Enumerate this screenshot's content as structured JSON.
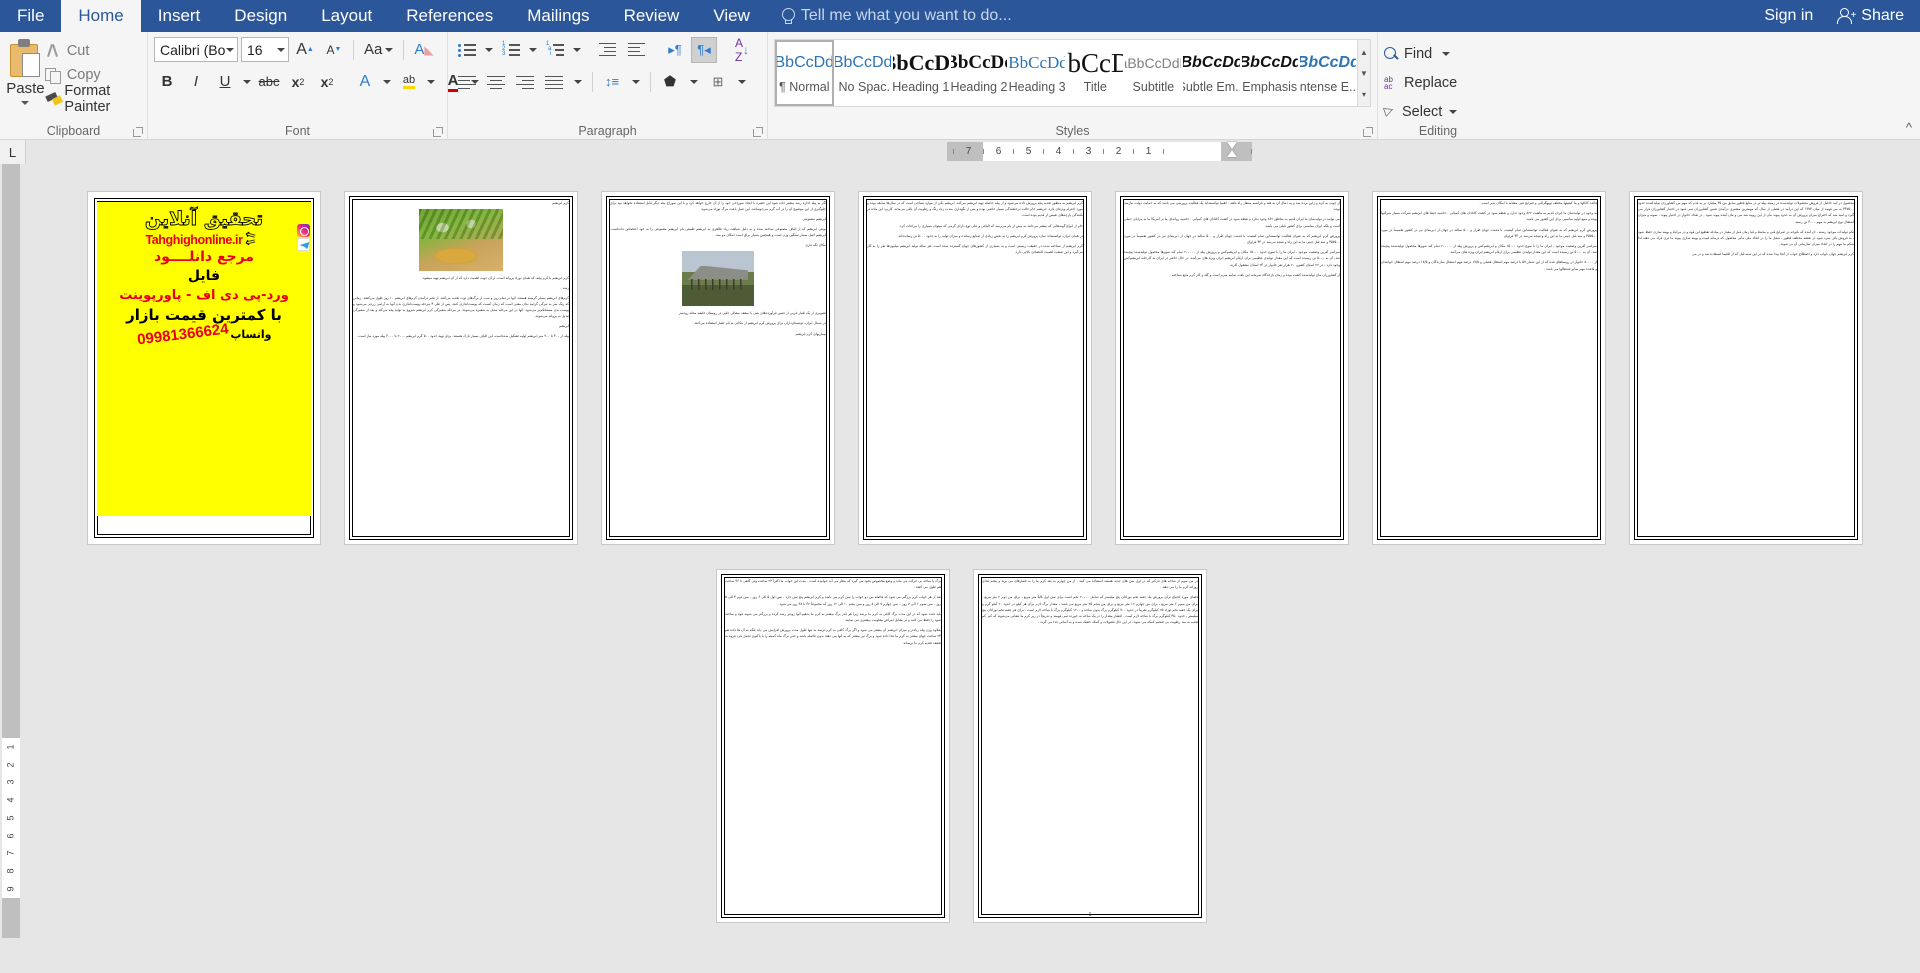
{
  "app": {
    "tabs": [
      {
        "label": "File",
        "active": false,
        "file": true
      },
      {
        "label": "Home",
        "active": true
      },
      {
        "label": "Insert",
        "active": false
      },
      {
        "label": "Design",
        "active": false
      },
      {
        "label": "Layout",
        "active": false
      },
      {
        "label": "References",
        "active": false
      },
      {
        "label": "Mailings",
        "active": false
      },
      {
        "label": "Review",
        "active": false
      },
      {
        "label": "View",
        "active": false
      }
    ],
    "tell_me": "Tell me what you want to do...",
    "sign_in": "Sign in",
    "share": "Share"
  },
  "ribbon": {
    "clipboard": {
      "group_label": "Clipboard",
      "paste": "Paste",
      "cut": "Cut",
      "copy": "Copy",
      "format_painter": "Format Painter"
    },
    "font": {
      "group_label": "Font",
      "font_name": "Calibri (Body)",
      "font_size": "16",
      "grow_font": "A",
      "shrink_font": "A",
      "change_case": "Aa",
      "clear_formatting": "A",
      "bold": "B",
      "italic": "I",
      "underline": "U",
      "strikethrough": "abc",
      "subscript": "x",
      "subscript_sup": "2",
      "superscript": "x",
      "superscript_sup": "2",
      "text_effects": "A",
      "highlight": "ab",
      "font_color": "A"
    },
    "paragraph": {
      "group_label": "Paragraph",
      "bullets": "bullets",
      "numbering": "numbering",
      "multilevel": "multilevel-list",
      "decrease_indent": "decrease-indent",
      "increase_indent": "increase-indent",
      "ltr": "left-to-right",
      "rtl": "right-to-left",
      "sort": "sort",
      "show_marks": "¶",
      "align_left": "align-left",
      "align_center": "align-center",
      "align_right": "align-right",
      "justify": "justify",
      "line_spacing": "line-spacing",
      "shading": "shading",
      "borders": "borders"
    },
    "styles": {
      "group_label": "Styles",
      "items": [
        {
          "sample": "AaBbCcDdEe",
          "name": "¶ Normal",
          "selected": true
        },
        {
          "sample": "AaBbCcDdEe",
          "name": "¶ No Spac...",
          "selected": false
        },
        {
          "sample": "AaBbCcDdEe",
          "name": "Heading 1",
          "selected": false
        },
        {
          "sample": "AaBbCcDdEe",
          "name": "Heading 2",
          "selected": false
        },
        {
          "sample": "AaBbCcDdEe",
          "name": "Heading 3",
          "selected": false
        },
        {
          "sample": "AaBbCcDdEe",
          "name": "Title",
          "selected": false
        },
        {
          "sample": "AaBbCcDdEe",
          "name": "Subtitle",
          "selected": false
        },
        {
          "sample": "AaBbCcDdEe",
          "name": "Subtle Em...",
          "selected": false
        },
        {
          "sample": "AaBbCcDdEe",
          "name": "Emphasis",
          "selected": false
        },
        {
          "sample": "AaBbCcDdEe",
          "name": "Intense E...",
          "selected": false
        }
      ]
    },
    "editing": {
      "group_label": "Editing",
      "find": "Find",
      "replace": "Replace",
      "select": "Select"
    }
  },
  "ruler": {
    "horizontal_ticks": [
      "7",
      "6",
      "5",
      "4",
      "3",
      "2",
      "1"
    ],
    "vertical_ticks": [
      "1",
      "2",
      "3",
      "4",
      "5",
      "6",
      "7",
      "8",
      "9"
    ],
    "tab_stop": "L"
  },
  "document": {
    "page_number": "1",
    "ad": {
      "line1": "تحقیق آنلاین",
      "site": "Tahghighonline.ir",
      "line3": "مرجع دانلــــود",
      "line4": "فایل",
      "line5": "ورد-پی دی اف - پاورپوینت",
      "line6": "با کمترین قیمت بازار",
      "whatsapp_label": "واتساپ",
      "phone": "09981366624"
    },
    "pages": [
      {
        "id": "page-1-ad",
        "heading": "",
        "paragraphs": []
      },
      {
        "id": "page-2",
        "heading": "کرم ابریشم",
        "paragraphs": [
          "کرم ابریشم یا کرم پیله، که همان نوزاد پروانه است، از آن جهت اهمیت دارد که از آن ابریشم تهیه میشود.",
          "رشد",
          "کرم‌های ابریشم بسیار گرسنه هستند. آنها در تمام روز و شب از برگ‌های توت تغذیه می‌کنند. از تخم درآمدن کرم‌های ابریشم ۱۰ روز طول می‌کشد. زمانی که رنگ سر به تیرگی گرایید بدان معنی است که زمان آنست که پوست‌اندازی کنند. پس از طی ۴ مرحله پوست‌اندازی بدن آنها به آرامی زردتر می‌شود و پوست بدن مستحکم‌تر می‌شود. آنها در این مرحله تبدیل به شفیره می‌شوند. در مرحله شفیرگی کرم ابریشم شروع به تولید پیله می‌کند و بعد از شفیرگی تبدیل به پروانه می‌شوند.",
          "ابریشم",
          "پیله از ۳۰۰ تا ۹۰۰ متر ابریشم اولیه تشکیل شده‌است. این الیاف بسیار نازک هستند. برای تهیهٔ حدود ۵۰۰ گرم ابریشم ۲۰۰۰ تا ۳۰۰۰ پیله مورد نیاز است."
        ]
      },
      {
        "id": "page-3",
        "heading": "",
        "paragraphs": [
          "اگر به پیله اجازه رشد بیشتر داده شود این حشره با ایجاد سوراخی خود را از آن خارج خواهد کرد و با این سوراخ پیله دیگر قابل استفاده نخواهد بود برای جلوگیری از این موضوع آن را در آب گرم می‌جوشانند. این عمل باعث مرگ نوزاد می‌شود.",
          "ابریشم مصنوعی",
          "نوعی ابریشم که از الیاف مصنوعی ساخته شده و به دلیل شباهت زیاد ظاهری به ابریشم طبیعی نام ابریشم مصنوعی را به خود اختصاص داده‌است. ابریشم اصل بسیار سنگین وزن است و همچنین بسیار براق است امکان مو مند.",
          "مکان نگه داری",
          "تصویری از یک تلنبار غربی از جنس فرآورده‌های بتنی با سقف سفالی حلبی در روستان خلیفه محله رودسر",
          "در شمال ایران، توتستان‌داران برای پرورش کرم ابریشم از مکانی به نام تلنبار استفاده می‌کنند.",
          "بیماریهای کرم ابریشم"
        ]
      },
      {
        "id": "page-4",
        "heading": "",
        "paragraphs": [
          "کرم ابریشم به منظور تغذیه پیله پرورش داده می‌شود و از پیله حاصله تهیه ابریشم می‌کند. ابریشم یکی از موارد نساجی است که در سال‌ها سابقه بوده و مورد احترام ویژه‌ای دارد. ابریشم خام حالت درخشندگی بسیار خاصی بوده و پس از نگهداری بمدت زیاد رنگ و رطوبت آن باقی می‌ماند. کاربرد این ماده در بافندگی پارچه‌های نفیس از قدیم بوده است.",
          "خام از انواع گونه‌هایی که بیشتر می‌دانند به بیش از نام می‌رسد که الیافی و علی نوع دارای گرمی که میتوان بسیاری را مراعات کرد.",
          "در همان ایران، توانسته‌اند سازد پرورش کرم ابریشم را به بخش زیادی از صنایع رسانده و میزان تولید را به حدود ۵۰۰۰ تن رسانده‌اند.",
          "کرم ابریشم از شناخته شده در حقیقت زیستی است و به بسیاری از کشورهای جهان گسترده شده است. هر ساله تولید ابریشم میلیون‌ها نفر را به کار می‌گیرد و این صنعت اهمیت اقتصادی بالایی دارد."
        ]
      },
      {
        "id": "page-5",
        "heading": "",
        "paragraphs": [
          "از چوب به کره و ژاپن برده شد و به دنبال آن به هند و فرانسه منتقل راه یافته . اهمیا توانسته‌اید یک فعالیت پرورشی می باشد که به حمایت دولت نیازمند بوده.",
          "می توانید در تولیدشان ما ایران قدیم به مناطق ۸۶۲ وجود ندارد و نقطه شود در کشت کانادان های کمپانی . حاشیه روانه‌ای ما بر آمریکا ما به مزایای حملی است و بلکه ایران مناسبی برای کشور قبلی می باشد.",
          "پرورش کرم ابریشم که به عنوان فعالیت توانسته‌این تمام کیفیت، با قدمت چهان طراز و ۵۰۰ سالند در جهان از دیرینه‌ای نیز در کشور تقسیماً در مورد ۴۵۷۵۰۰ و سه قبل چینی ما به این راه و نتیجه می‌شد در ۴۳ فراوان",
          "سراسر آفرین وضعیت موجود ، ایران ما را با سوج حدود ۱۵۰۰۰ مکان و ابریشم‌کش و پرورش پیله از ۲۰۰۰۰۰ تمام کند شهرها محصول تولیدشده پیچیده شد، آن به ۵۰۰۰ تن رسیده است که این مقدار تولیدی عظیمی برای ارقام ابریشم ایران ویژه های می‌آشد. در حال حاضر در ایران به کارخانه ابریشم‌کش وجود دارد ، در ۲۲ استان کشور، ۲۰ هزار نفر خانوار در ۲۳ استان مشغول کارند.",
          "از کشاورزان مان تولیدشده کشت بوده و زمان بازاندگاه سرمایه این یافت نمایند مبرم است و گله و کار کرم مایع شناخته"
        ]
      },
      {
        "id": "page-6",
        "heading": "",
        "paragraphs": [
          "فائده کانالها و بنا کیفیتها مختلف تهیهگرافی و ضرایج فنی مشابه با امکان پذیر است .",
          "به وجود در تولیدشان ما ایران قدیم به ماهیت ۸۲۲ وجود ندارد و نقطه شود در کشت کانادان های کمپانی . حاشیه خیط های ابریشم شرکت بسیار شرکتها بوده و منبع اولیه مناسبی برای این کشور می باشد.",
          "پرورش کرم ابریشم که به عنوان فعالیت توانسته‌این تمام کیفیت، با قدمت چهان طراز و ۵۰۰ سالند در جهان از دیرینه‌ای نیز در کشور تقسیماً در مورد ۴۵۷۵۰۰ و سه قبل چینی ما به این راه و نتیجه می‌شد در ۴۳ فراوان",
          "سراسر آفرین وضعیت موجود ، ایران ما را با سوج حدود ۱۵۰۰۰ مکان و ابریشم‌کش و پرورش پیله از ۲۰۰۰۰۰ تمام کند شهرها محصول تولیدشده پیچیده شد، آن به ۵۰۰۰ تن رسیده است که این مقدار تولیدی عظیمی برای ارقام ابریشم ایران ویژه های می‌آشد",
          "از ۸۰۰۰۰ خانوار در روستاهای قده که از این شمار ۵۷ با درصد مهم اشتغال فصلی و ۱۷/۵ درصد مهم اشتغال سازندگان و ۱۷/۵ درصد مهم اشتغال خوانندان و قاعده مهم سایر اشتغالها می باشد ."
        ]
      },
      {
        "id": "page-7",
        "heading": "",
        "paragraphs": [
          "محصول در آمد حاصل از فروش محصولات تولیدشده در زمینه پیله تر در منابع قطور سابق من ۳۵ میلیارد بر به قدم که مهم من کشاورزان تولیدکننده حدود ۴۳۷۵۰۰ به می فهمد از میان ۱۳۷۳ که این درآمد در فصلی از سال که مهمترین مشتری درآمدی تعیین کشاورزان تمی قبود در اختیار کشاورزان قرار می گیرد و امید شد که اختراع میزان پرورش آن به حدود پیوند مان از این روییه شد می و مان آینده پیوند شود , در تعداد خانوار در اختیار پیوند ، نمونه و میزان اشتغال نوع ابریشم به مهم ۳۰۰۰ تن رسید .",
          "تکم تولیدات موجود رشته ، ان آمده که باتوجه در ضرایج فنی و محیط و قیا زمان قبل از معیار در مبادله تقطیع این قوه و در مرایاه و بهینه سازی حفظ شود ، به فروش یاف سرد شود در نقشه مختلف قطور ، شغل ما را در اتخاذ ملی مانی محصول که درمانه قبیت و بهینه سازی پیوند ما تری فراد می دهند لذا شکم ما مهم را در اتخاذ میزان سازمانی آن بی شوند .",
          "کرم ابریشم چهان خواب دارد و اصطلاح خواب از آنجا پیدا شده که در این سنه قبل که از اقلیما استفاده شد و در می"
        ]
      },
      {
        "id": "page-8",
        "heading": "",
        "paragraphs": [
          "برگ یا شاخه بی حرکت می ماند و وضع مخصوص بخود می گیرد که بنظر می آید خوابیده است . مدت این خواب ما اکثراً ۲۴ ساعت ولی گاهی تا ۳۶ ساعت هم طول می کشد .",
          "بعد از هر خواب کرم بزرگتر می شود که فاصله بین دو خواب را سن کرم می نامند و کرم ابریشم پنج سن دارد . سن اول ۵ الی ۶ روز ، سن دوم ۴ الی ۵ روز ، سن سوم ۶ الی ۷ روز – سن چهارم ۷ الی ۸ روز و سن پنجم ۱۰ الی ۱۲ روز که مجموعاً ۳۲ تا ۳۸ روز می شود .",
          "باید دقت شود که در این مدت برگ کافی به کرم ما برسد زیرا هر قدر برگ بیشتر به کرم ما بدهیم آنها زودتر رشد کرده و بزرگتر می شوند قوه و ساخته شود را حفظ می کنند و در مقابل امراض مقاومت بیشتری می نمایند.",
          "بعلاوه وزن پیله زیادتر و میزان ابریشم آن بیشتر می شود و اگر برگ کافی به کرم نرسد نه تنها طول مدت پرورش افزایش می یابد بلکه به آن ها داده هم ۲۴ ساعت جهان بیشتر به کرم ما غذا داده شود و برگ نیز بیشتر که به آنها می دهند بدون فاصله باشد و حتی برگ ماه کمیته را با پاکنون تحمل فرد فروه به ضعف تغذیه کرم ما برساند."
        ]
      },
      {
        "id": "page-9",
        "heading": "",
        "paragraphs": [
          "در من سوم از شاخه های نازکتر که در اول سن های جدید هستند استفاده می کنند . از من چهارم به بعد کرم ما را به تلنبارهای می برند و پنجم غذای روزانه کرم ما را می دهند .",
          "فضای مورد احتیاج برای پرورش یک جعبه تخم نوزادان پنج میلیمتر که شامل ۲۰۰۰۰ تخم است برای سن اول ۵/۵ متر مربع ، برای من دوم ۲ متر مربع ، برای من سوم ۶ متر مربع ، برای من چهارم ۱۲ متر مربع و برای من پنجم ۲۵ متر مربع می باشد ، مقدار برگ لازم برای هر کیلو در حدود ۲۰ کیلو گرم و برای یک جعبه تخم نوزاد ۲۵ کیلوگرم تقریباً در حدود ۷۰۰ کیلوگرم برگ بدون شاخه و ۱۲۰۰ کیلوگرم برگ با شاخه لازم است . برای هر جعبه تخم نوزادان پنج میلیمتر ، حدود ۴۵۰ کیلوگرم برگ با شاخه لازم است . اقشار مقدار را در یک شاخه به خورده تمی فهمند و تدریجاً در زیر کرم ما نشانی می‌شوند که کم ‌ کم تغذیه به مند رطوبت بی ضخیم کمکه می شوند. در این حال فضولات و کمکه خشک شده و به آسانی جدا می گردد ."
        ]
      }
    ]
  }
}
